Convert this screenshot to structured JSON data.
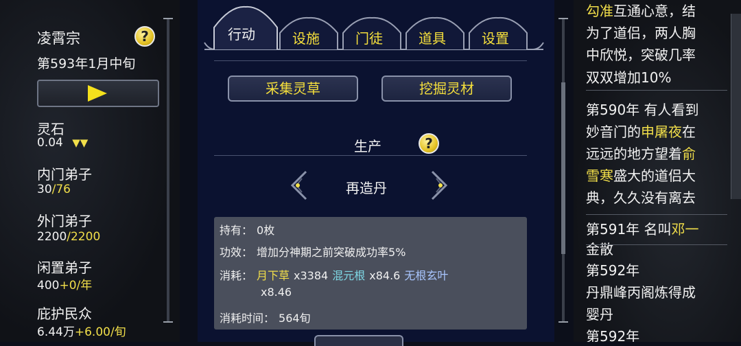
{
  "sidebar": {
    "sect_name": "凌霄宗",
    "help": "?",
    "date": "第593年1月中旬",
    "stats": [
      {
        "label": "灵石",
        "value": "0.04",
        "suffix": "▼▼"
      },
      {
        "label": "内门弟子",
        "value": "30",
        "suffix": "/76"
      },
      {
        "label": "外门弟子",
        "value": "2200",
        "suffix": "/2200"
      },
      {
        "label": "闲置弟子",
        "value": "400",
        "suffix": "+0/年"
      },
      {
        "label": "庇护民众",
        "value": "6.44万",
        "suffix": "+6.00/旬"
      }
    ]
  },
  "tabs": {
    "action": "行动",
    "facilities": "设施",
    "disciples": "门徒",
    "items": "道具",
    "settings": "设置"
  },
  "actions": {
    "gather_herbs": "采集灵草",
    "dig_materials": "挖掘灵材"
  },
  "production": {
    "title": "生产",
    "help": "?",
    "item_name": "再造丹",
    "owned_label": "持有：",
    "owned_value": "0枚",
    "effect_label": "功效：",
    "effect_value": "增加分神期之前突破成功率5%",
    "cost_label": "消耗：",
    "costs": [
      {
        "name": "月下草",
        "qty": "x3384"
      },
      {
        "name": "混元根",
        "qty": "x84.6"
      },
      {
        "name": "无根玄叶",
        "qty": "x8.46"
      }
    ],
    "time_label": "消耗时间：",
    "time_value": "564旬"
  },
  "log": {
    "lines": [
      {
        "segments": [
          {
            "t": "勾准",
            "hl": true
          },
          {
            "t": "互通心意，结",
            "hl": false
          }
        ]
      },
      {
        "segments": [
          {
            "t": "为了道侣，两人胸",
            "hl": false
          }
        ]
      },
      {
        "segments": [
          {
            "t": "中欣悦，突破几率",
            "hl": false
          }
        ]
      },
      {
        "segments": [
          {
            "t": "双双增加10%",
            "hl": false
          }
        ]
      },
      {
        "segments": [
          {
            "t": "第590年 有人看到",
            "hl": false
          }
        ]
      },
      {
        "segments": [
          {
            "t": "妙音门的",
            "hl": false
          },
          {
            "t": "申屠夜",
            "hl": true
          },
          {
            "t": "在",
            "hl": false
          }
        ]
      },
      {
        "segments": [
          {
            "t": "远远的地方望着",
            "hl": false
          },
          {
            "t": "俞",
            "hl": true
          }
        ]
      },
      {
        "segments": [
          {
            "t": "雪寒",
            "hl": true
          },
          {
            "t": "盛大的道侣大",
            "hl": false
          }
        ]
      },
      {
        "segments": [
          {
            "t": "典，久久没有离去",
            "hl": false
          }
        ]
      },
      {
        "segments": [
          {
            "t": "第591年 名叫",
            "hl": false
          },
          {
            "t": "邓一",
            "hl": true
          }
        ]
      },
      {
        "segments": [
          {
            "t": "金散",
            "hl": false
          }
        ]
      },
      {
        "segments": [
          {
            "t": "第592年",
            "hl": false
          }
        ]
      },
      {
        "segments": [
          {
            "t": "丹鼎峰丙阁炼得成",
            "hl": false
          }
        ]
      },
      {
        "segments": [
          {
            "t": "婴丹",
            "hl": false
          }
        ]
      },
      {
        "segments": [
          {
            "t": "第592年",
            "hl": false
          }
        ]
      }
    ]
  },
  "colors": {
    "accent_yellow": "#f2df4a",
    "cyan_material": "#7fd9e6",
    "blue_material": "#a9c6ff",
    "panel_navy": "#0b1230"
  }
}
